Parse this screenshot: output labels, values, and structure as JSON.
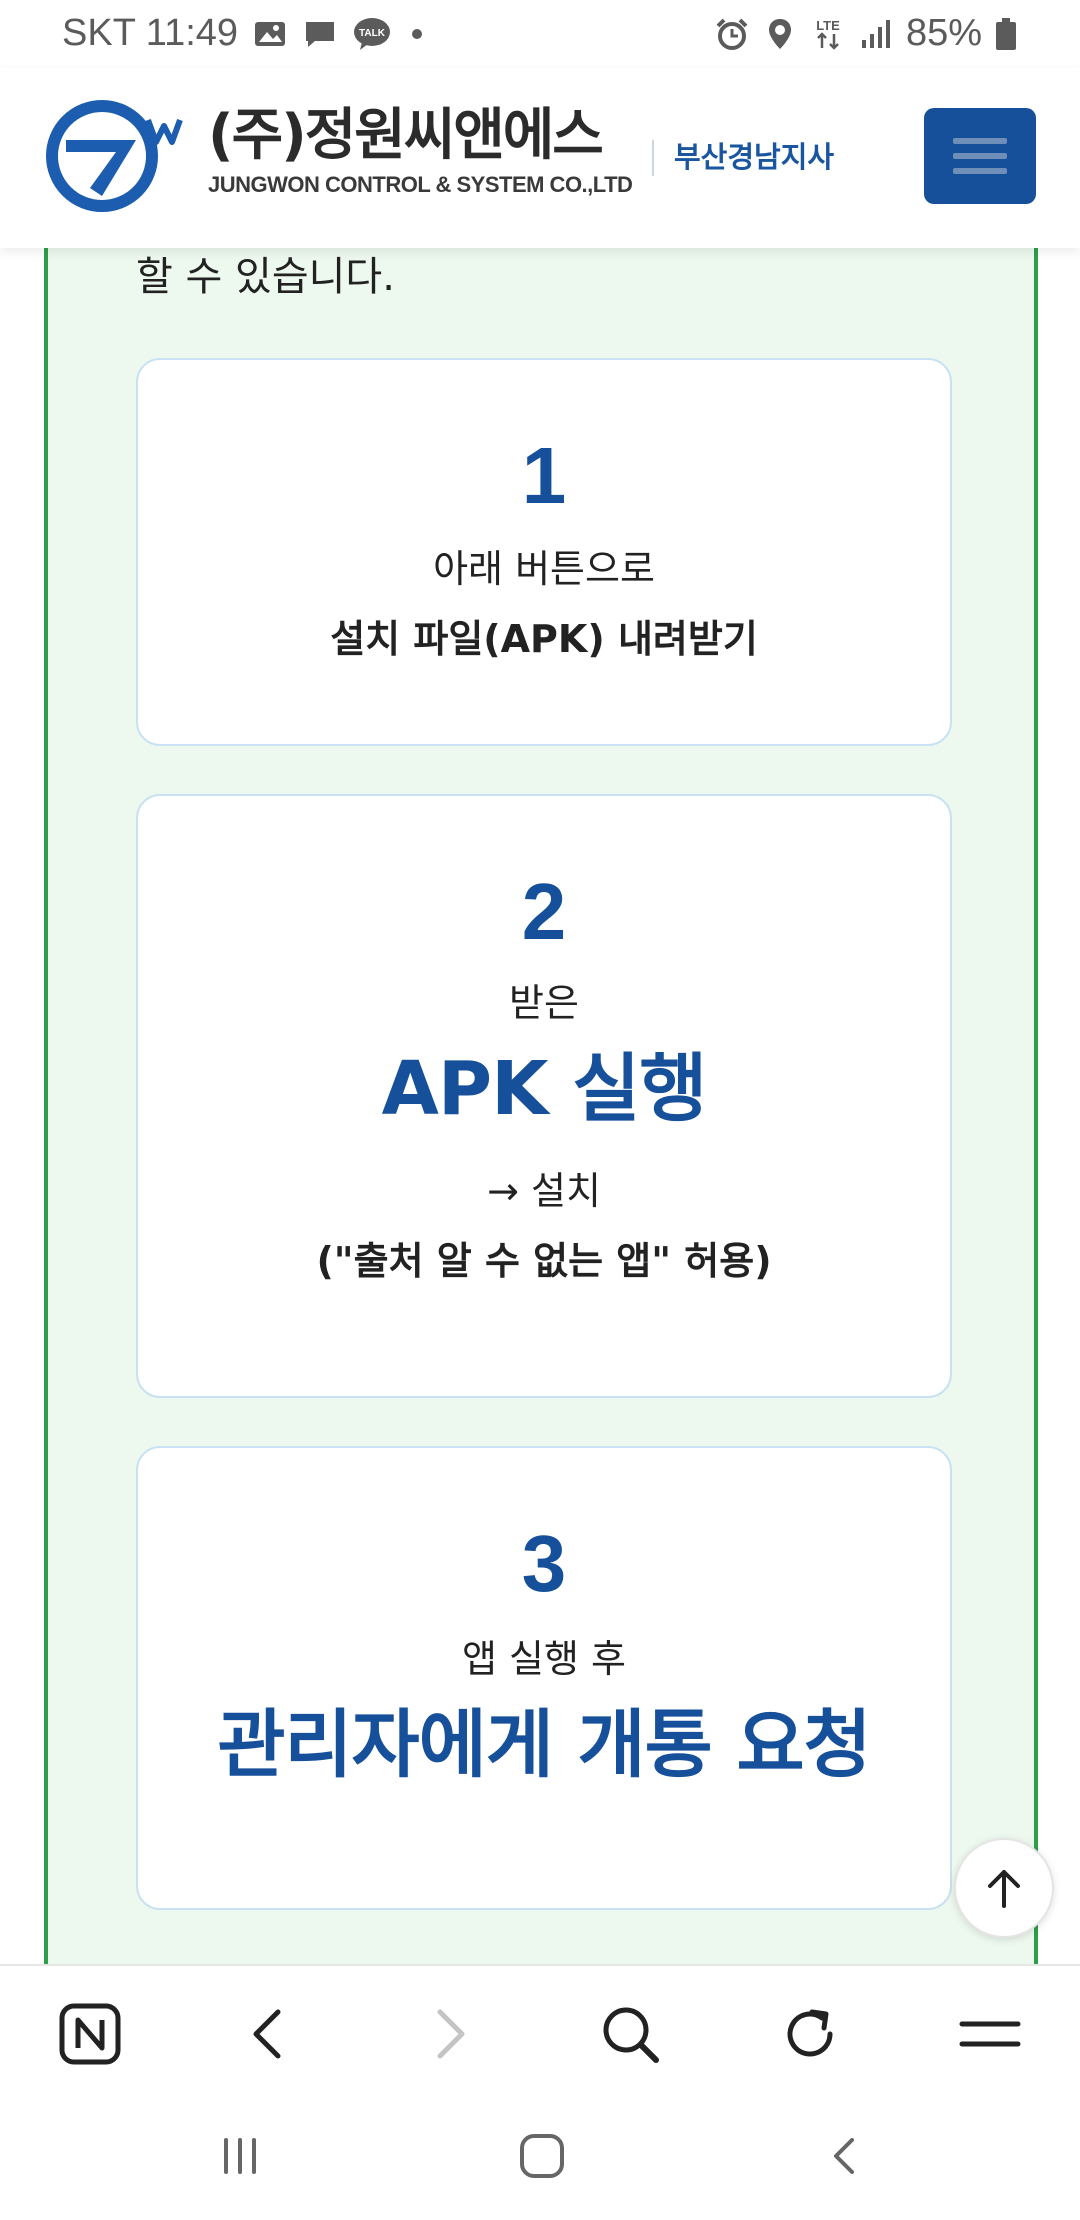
{
  "status_bar": {
    "carrier_time": "SKT 11:49",
    "talk_badge": "TALK",
    "network": "LTE",
    "battery": "85%"
  },
  "header": {
    "logo_main": "(주)정원씨앤에스",
    "logo_sub": "JUNGWON CONTROL & SYSTEM CO.,LTD",
    "branch": "부산경남지사",
    "colors": {
      "brand_blue": "#17509a",
      "logo_blue": "#1d5db0"
    }
  },
  "content": {
    "intro_tail": "할 수 있습니다.",
    "steps": [
      {
        "number": "1",
        "line1": "아래 버튼으로",
        "line2": "설치 파일(APK) 내려받기"
      },
      {
        "number": "2",
        "pre": "받은",
        "emphasis": "APK 실행",
        "line1": "→ 설치",
        "line2": "(\"출처 알 수 없는 앱\" 허용)"
      },
      {
        "number": "3",
        "pre": "앱 실행 후",
        "emphasis": "관리자에게 개통 요청"
      }
    ],
    "colors": {
      "panel_bg": "#edf8ee",
      "panel_border": "#2e9e4a"
    }
  },
  "icons": {
    "scroll_top": "arrow-up-icon",
    "toolbar": [
      "naver-home-icon",
      "back-icon",
      "forward-icon",
      "search-icon",
      "refresh-icon",
      "menu-icon"
    ],
    "system": [
      "recent-apps-icon",
      "home-icon",
      "system-back-icon"
    ]
  }
}
